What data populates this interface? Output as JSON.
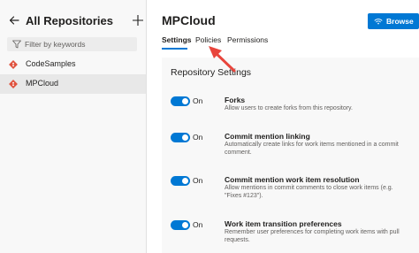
{
  "sidebar": {
    "title": "All Repositories",
    "filter_placeholder": "Filter by keywords",
    "repos": [
      {
        "label": "CodeSamples",
        "selected": false
      },
      {
        "label": "MPCloud",
        "selected": true
      }
    ],
    "repo_icon_color": "#e0533f"
  },
  "main": {
    "title": "MPCloud",
    "browse_label": "Browse",
    "tabs": [
      {
        "label": "Settings",
        "active": true
      },
      {
        "label": "Policies",
        "active": false
      },
      {
        "label": "Permissions",
        "active": false
      }
    ],
    "section_title": "Repository Settings",
    "settings": [
      {
        "name": "Forks",
        "description": "Allow users to create forks from this repository.",
        "toggle_label": "On",
        "enabled": true
      },
      {
        "name": "Commit mention linking",
        "description": "Automatically create links for work items mentioned in a commit comment.",
        "toggle_label": "On",
        "enabled": true
      },
      {
        "name": "Commit mention work item resolution",
        "description": "Allow mentions in commit comments to close work items (e.g. \"Fixes #123\").",
        "toggle_label": "On",
        "enabled": true
      },
      {
        "name": "Work item transition preferences",
        "description": "Remember user preferences for completing work items with pull requests.",
        "toggle_label": "On",
        "enabled": true
      }
    ]
  },
  "annotation": {
    "type": "red-arrow",
    "points_to": "tab-policies",
    "color": "#e8453c"
  },
  "colors": {
    "accent": "#0078d4",
    "sidebar_bg": "#f8f8f8",
    "content_bg": "#f8f8f8"
  }
}
